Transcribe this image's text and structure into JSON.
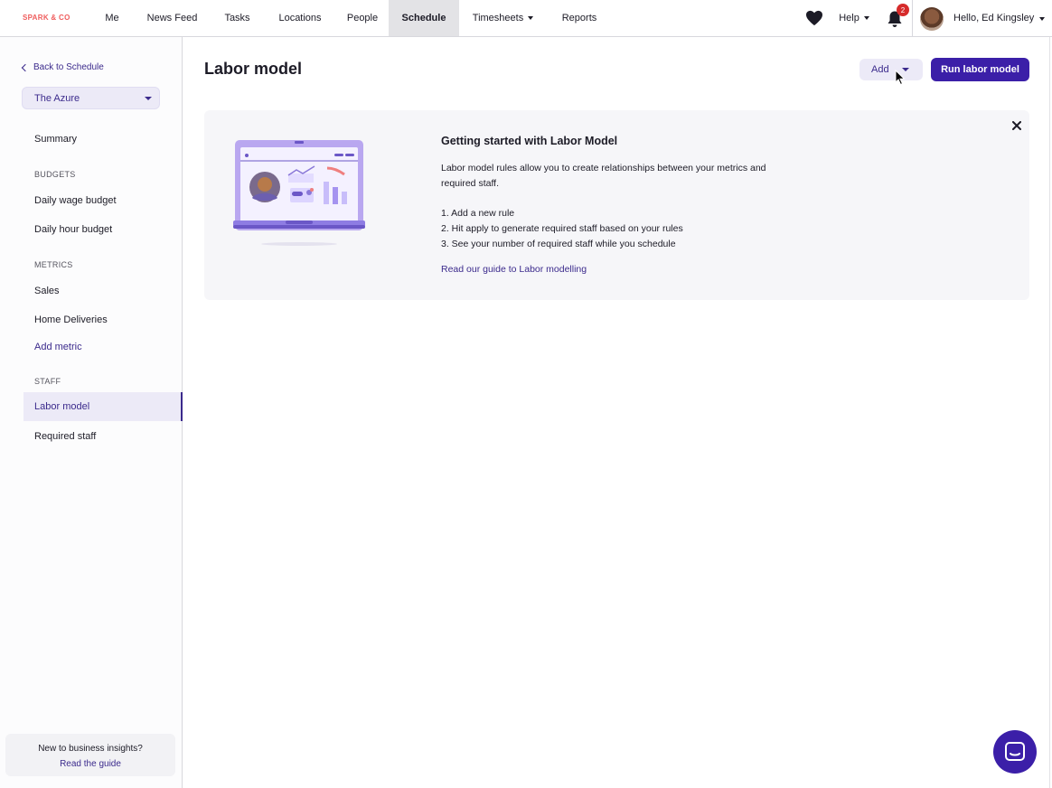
{
  "topnav": {
    "brand": "SPARK & CO",
    "items": [
      {
        "label": "Me"
      },
      {
        "label": "News Feed"
      },
      {
        "label": "Tasks"
      },
      {
        "label": "Locations"
      },
      {
        "label": "People"
      },
      {
        "label": "Schedule",
        "active": true
      },
      {
        "label": "Timesheets",
        "dropdown": true
      },
      {
        "label": "Reports"
      }
    ],
    "help_label": "Help",
    "notifications_count": "2",
    "greeting": "Hello, Ed Kingsley",
    "icons": [
      "heart-icon",
      "bell-icon",
      "user-avatar"
    ]
  },
  "sidebar": {
    "back_label": "Back to Schedule",
    "location": "The Azure",
    "summary": "Summary",
    "budgets_heading": "BUDGETS",
    "daily_wage_budget": "Daily wage budget",
    "daily_hour_budget": "Daily hour budget",
    "metrics_heading": "METRICS",
    "sales": "Sales",
    "home_deliveries": "Home Deliveries",
    "add_metric": "Add metric",
    "staff_heading": "STAFF",
    "labor_model": "Labor model",
    "required_staff": "Required staff",
    "footer_text": "New to business insights?",
    "footer_link": "Read the guide"
  },
  "main": {
    "title": "Labor model",
    "add_label": "Add",
    "run_label": "Run labor model",
    "card": {
      "title": "Getting started with Labor Model",
      "description": "Labor model rules allow you to create relationships between your metrics and required staff.",
      "step1": "1. Add a new rule",
      "step2": "2. Hit apply to generate required staff based on your rules",
      "step3": "3. See your number of required staff while you schedule",
      "guide_link": "Read our guide to Labor modelling"
    }
  },
  "colors": {
    "accent": "#3b1fa8",
    "accent_text": "#3b2a8c",
    "accent_light": "#eceaf7",
    "brand": "#ef5d5d",
    "badge": "#d62b2b"
  }
}
